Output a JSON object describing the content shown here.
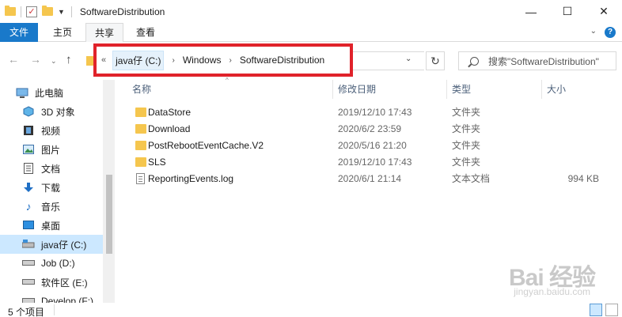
{
  "window": {
    "title": "SoftwareDistribution",
    "minimize": "—",
    "maximize": "☐",
    "close": "✕"
  },
  "ribbon": {
    "tabs": [
      "文件",
      "主页",
      "共享",
      "查看"
    ],
    "expand": "⌄",
    "help": "?"
  },
  "nav": {
    "back": "←",
    "forward": "→",
    "recent": "⌄",
    "up": "↑",
    "address_overflow": "«",
    "breadcrumb": [
      "java仔 (C:)",
      "Windows",
      "SoftwareDistribution"
    ],
    "dropdown": "⌄",
    "refresh": "↻",
    "search_placeholder": "搜索\"SoftwareDistribution\""
  },
  "sidebar": {
    "items": [
      {
        "label": "此电脑",
        "icon": "computer-icon"
      },
      {
        "label": "3D 对象",
        "icon": "cube-icon"
      },
      {
        "label": "视频",
        "icon": "film-icon"
      },
      {
        "label": "图片",
        "icon": "picture-icon"
      },
      {
        "label": "文档",
        "icon": "document-icon"
      },
      {
        "label": "下载",
        "icon": "download-icon"
      },
      {
        "label": "音乐",
        "icon": "music-icon"
      },
      {
        "label": "桌面",
        "icon": "desktop-icon"
      },
      {
        "label": "java仔 (C:)",
        "icon": "drive-icon",
        "selected": true
      },
      {
        "label": "Job (D:)",
        "icon": "drive-icon"
      },
      {
        "label": "软件区 (E:)",
        "icon": "drive-icon"
      },
      {
        "label": "Develop (F:)",
        "icon": "drive-icon"
      }
    ]
  },
  "columns": {
    "name": "名称",
    "modified": "修改日期",
    "type": "类型",
    "size": "大小",
    "sort_indicator": "^"
  },
  "files": [
    {
      "name": "DataStore",
      "modified": "2019/12/10 17:43",
      "type": "文件夹",
      "size": "",
      "kind": "folder"
    },
    {
      "name": "Download",
      "modified": "2020/6/2 23:59",
      "type": "文件夹",
      "size": "",
      "kind": "folder"
    },
    {
      "name": "PostRebootEventCache.V2",
      "modified": "2020/5/16 21:20",
      "type": "文件夹",
      "size": "",
      "kind": "folder"
    },
    {
      "name": "SLS",
      "modified": "2019/12/10 17:43",
      "type": "文件夹",
      "size": "",
      "kind": "folder"
    },
    {
      "name": "ReportingEvents.log",
      "modified": "2020/6/1 21:14",
      "type": "文本文档",
      "size": "994 KB",
      "kind": "file"
    }
  ],
  "status": {
    "count": "5 个项目"
  },
  "watermark": {
    "main": "Bai 经验",
    "sub": "jingyan.baidu.com"
  },
  "colors": {
    "accent": "#1979ca",
    "highlight_box": "#e0222a",
    "selection": "#cce8ff",
    "folder": "#f5c64e"
  }
}
